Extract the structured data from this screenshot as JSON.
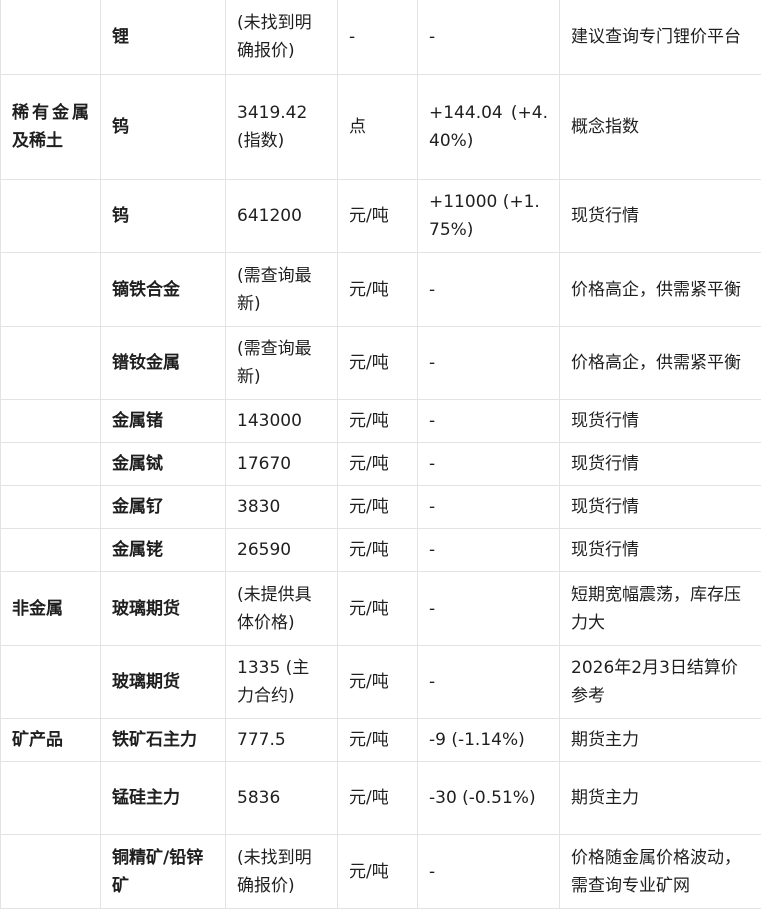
{
  "rows": [
    {
      "category": "",
      "name": "锂",
      "price": "(未找到明确报价)",
      "unit": "-",
      "change": "-",
      "note": "建议查询专门锂价平台"
    },
    {
      "category": "稀有金属及稀土",
      "name": "钨",
      "price": "3419.42 (指数)",
      "unit": "点",
      "change": "+144.04 (+4.40%)",
      "note": "概念指数"
    },
    {
      "category": "",
      "name": "钨",
      "price": "641200",
      "unit": "元/吨",
      "change": "+11000 (+1.75%)",
      "note": "现货行情"
    },
    {
      "category": "",
      "name": "镝铁合金",
      "price": "(需查询最新)",
      "unit": "元/吨",
      "change": "-",
      "note": "价格高企，供需紧平衡"
    },
    {
      "category": "",
      "name": "镨钕金属",
      "price": "(需查询最新)",
      "unit": "元/吨",
      "change": "-",
      "note": "价格高企，供需紧平衡"
    },
    {
      "category": "",
      "name": "金属锗",
      "price": "143000",
      "unit": "元/吨",
      "change": "-",
      "note": "现货行情"
    },
    {
      "category": "",
      "name": "金属铽",
      "price": "17670",
      "unit": "元/吨",
      "change": "-",
      "note": "现货行情"
    },
    {
      "category": "",
      "name": "金属钌",
      "price": "3830",
      "unit": "元/吨",
      "change": "-",
      "note": "现货行情"
    },
    {
      "category": "",
      "name": "金属铑",
      "price": "26590",
      "unit": "元/吨",
      "change": "-",
      "note": "现货行情"
    },
    {
      "category": "非金属",
      "name": "玻璃期货",
      "price": "(未提供具体价格)",
      "unit": "元/吨",
      "change": "-",
      "note": "短期宽幅震荡，库存压力大"
    },
    {
      "category": "",
      "name": "玻璃期货",
      "price": "1335 (主力合约)",
      "unit": "元/吨",
      "change": "-",
      "note": "2026年2月3日结算价参考"
    },
    {
      "category": "矿产品",
      "name": "铁矿石主力",
      "price": "777.5",
      "unit": "元/吨",
      "change": "-9 (-1.14%)",
      "note": "期货主力"
    },
    {
      "category": "",
      "name": "锰硅主力",
      "price": "5836",
      "unit": "元/吨",
      "change": "-30 (-0.51%)",
      "note": "期货主力"
    },
    {
      "category": "",
      "name": "铜精矿/铅锌矿",
      "price": "(未找到明确报价)",
      "unit": "元/吨",
      "change": "-",
      "note": "价格随金属价格波动，需查询专业矿网"
    }
  ]
}
